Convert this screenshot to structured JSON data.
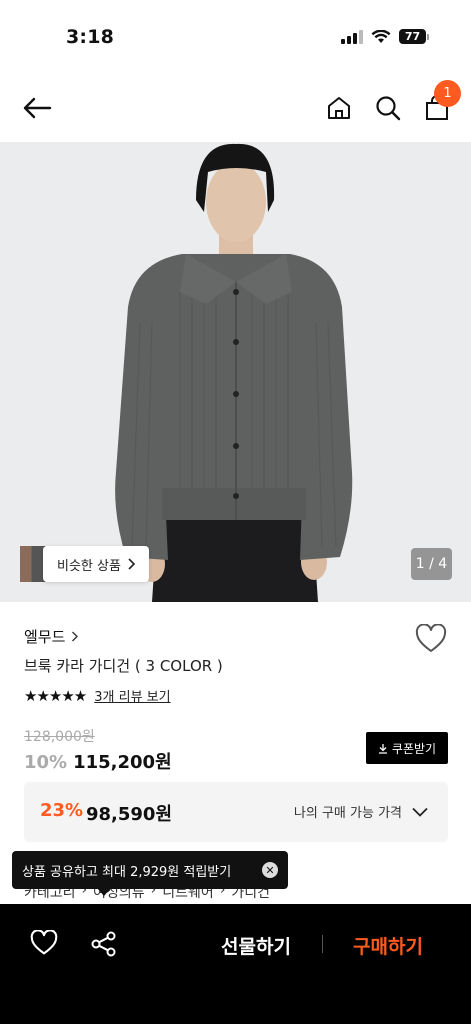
{
  "status": {
    "time": "3:18",
    "battery": "77"
  },
  "nav": {
    "cart_count": "1"
  },
  "gallery": {
    "similar_label": "비슷한 상품",
    "page": "1 / 4"
  },
  "product": {
    "brand": "엘무드",
    "name": "브룩 카라 가디건 ( 3 COLOR )",
    "rating": 5,
    "review_link": "3개 리뷰 보기",
    "original_price": "128,000원",
    "discount": "10%",
    "price": "115,200원",
    "coupon_label": "쿠폰받기",
    "my_discount": "23%",
    "my_price": "98,590원",
    "my_price_label": "나의 구매 가능 가격"
  },
  "breadcrumb": [
    "카테고리",
    "여성의류",
    "니트웨어",
    "가디건"
  ],
  "tooltip": {
    "text": "상품 공유하고 최대 2,929원 적립받기"
  },
  "bottom": {
    "gift_label": "선물하기",
    "buy_label": "구매하기"
  },
  "colors": {
    "accent": "#ff5a1f",
    "dark": "#000000"
  }
}
